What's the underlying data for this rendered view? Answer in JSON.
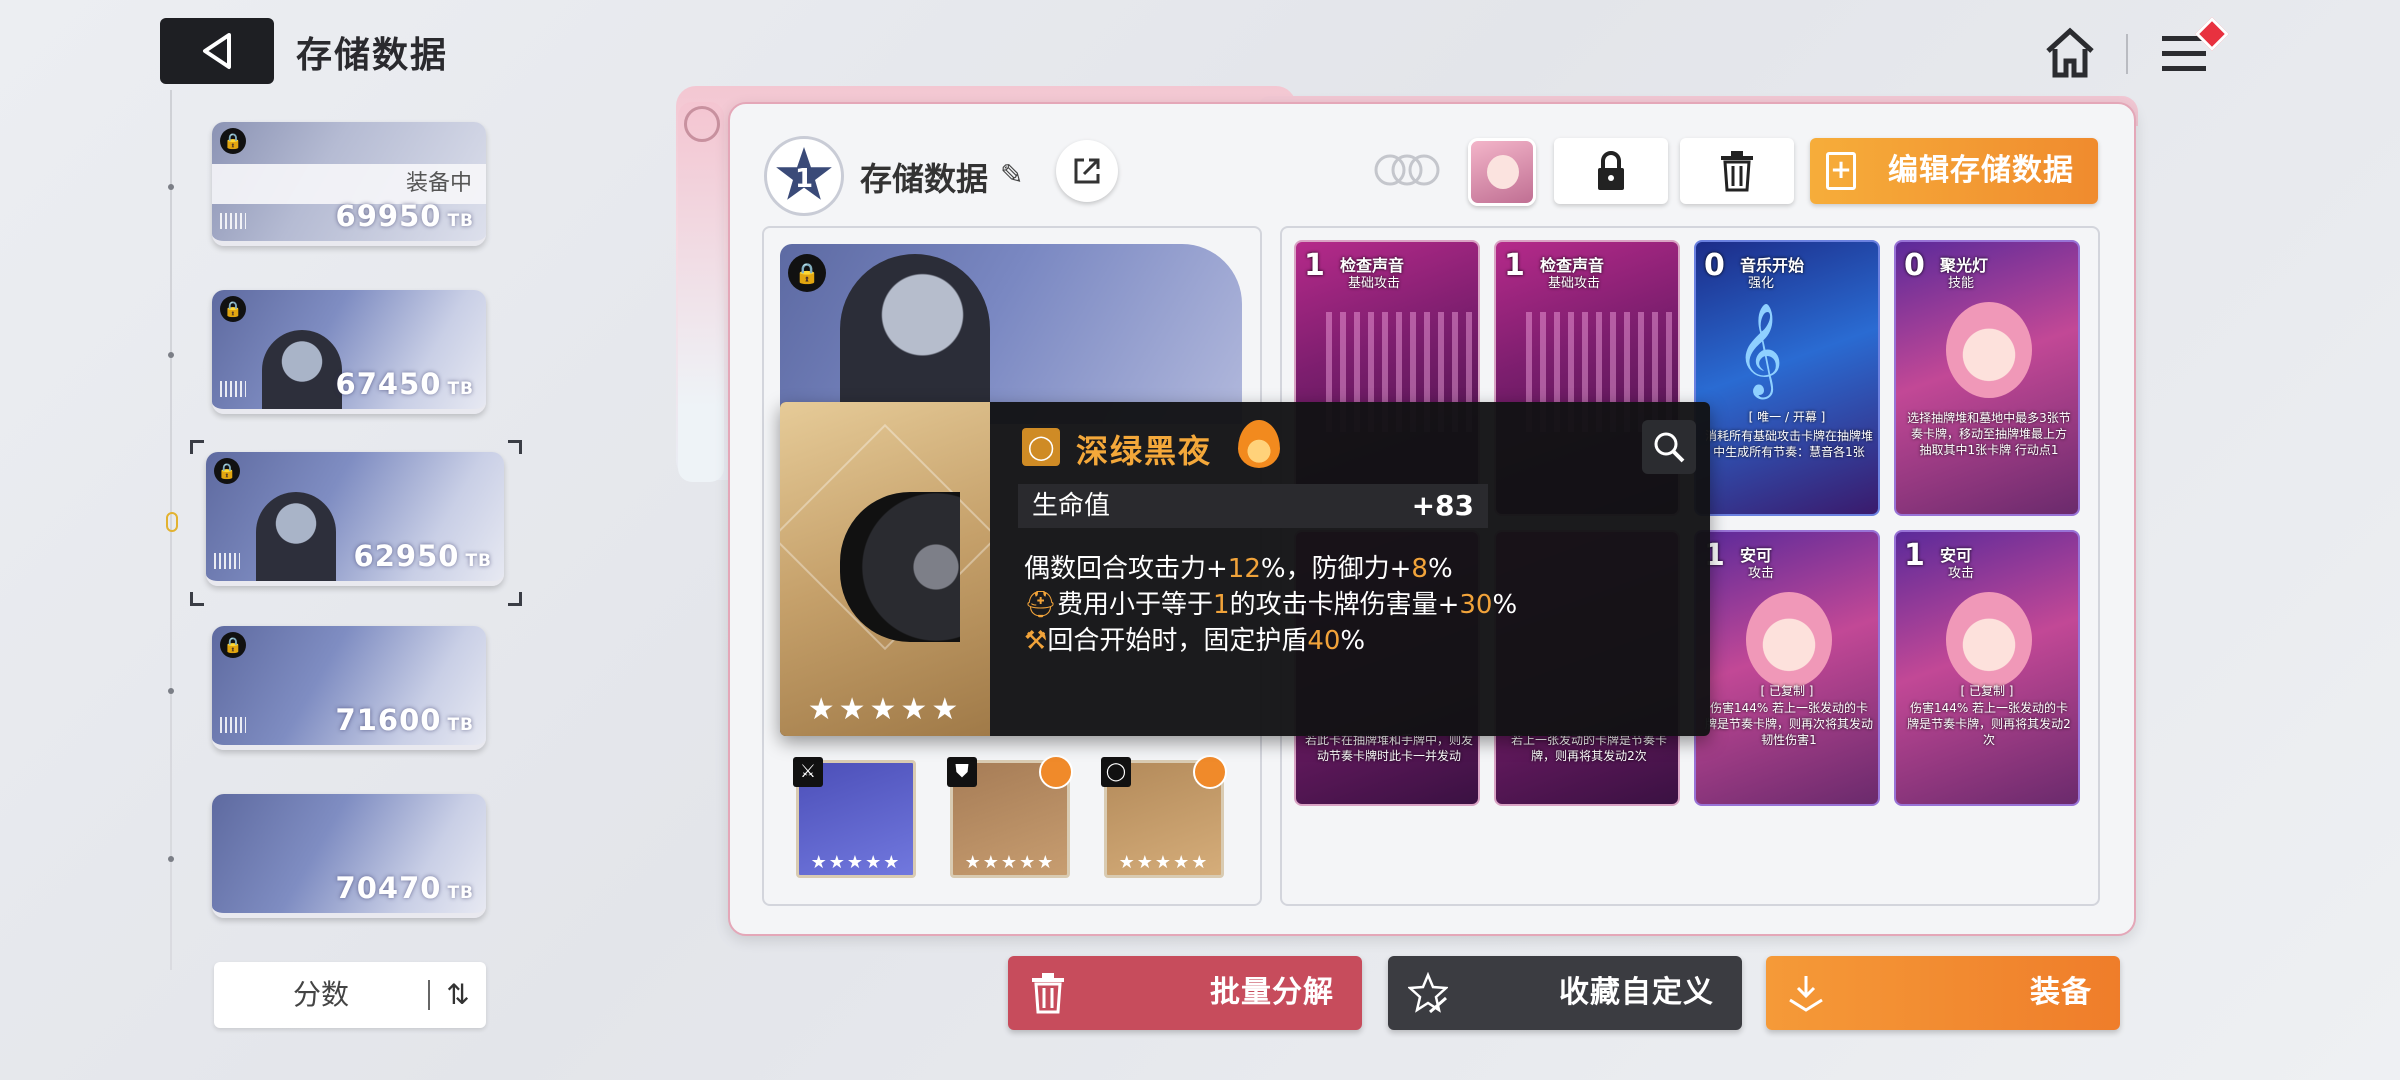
{
  "header": {
    "title": "存储数据"
  },
  "slots": [
    {
      "score": "69950",
      "unit": "TB",
      "status": "装备中"
    },
    {
      "score": "67450",
      "unit": "TB"
    },
    {
      "score": "62950",
      "unit": "TB"
    },
    {
      "score": "71600",
      "unit": "TB"
    },
    {
      "score": "70470",
      "unit": "TB"
    }
  ],
  "sort": {
    "label": "分数"
  },
  "panel": {
    "level": "1",
    "title": "存储数据",
    "edit_label": "编辑存储数据"
  },
  "popup": {
    "name": "深绿黑夜",
    "stat_name": "生命值",
    "stat_value": "+83",
    "effect1_a": "偶数回合攻击力+",
    "effect1_b": "12",
    "effect1_c": "%，防御力+",
    "effect1_d": "8",
    "effect1_e": "%",
    "effect2_a": "费用小于等于",
    "effect2_b": "1",
    "effect2_c": "的攻击卡牌伤害量+",
    "effect2_d": "30",
    "effect2_e": "%",
    "effect3_a": "回合开始时，固定护盾",
    "effect3_b": "40",
    "effect3_c": "%",
    "stars": "★★★★★"
  },
  "cards": [
    {
      "cost": "1",
      "name": "检查声音",
      "type": "基础攻击",
      "desc": "若此卡在抽牌堆和手牌中，则发动节奏卡牌时此卡一并发动"
    },
    {
      "cost": "1",
      "name": "检查声音",
      "type": "基础攻击",
      "desc": "若上一张发动的卡牌是节奏卡牌，则再将其发动2次"
    },
    {
      "cost": "0",
      "name": "音乐开始",
      "type": "强化",
      "tag": "[ 唯一 / 开幕 ]",
      "desc": "消耗所有基础攻击卡牌在抽牌堆中生成所有节奏：慧音各1张"
    },
    {
      "cost": "0",
      "name": "聚光灯",
      "type": "技能",
      "desc": "选择抽牌堆和墓地中最多3张节奏卡牌，移动至抽牌堆最上方 抽取其中1张卡牌 行动点1"
    },
    {
      "cost": "1",
      "name": "安可",
      "type": "攻击",
      "tag": "[ 已复制 ]",
      "desc": "伤害144% 若上一张发动的卡牌是节奏卡牌，则再次将其发动 韧性伤害1"
    },
    {
      "cost": "1",
      "name": "安可",
      "type": "攻击",
      "tag": "[ 已复制 ]",
      "desc": "伤害144% 若上一张发动的卡牌是节奏卡牌，则再将其发动2次"
    }
  ],
  "equipment": [
    {
      "stars": "★★★★★"
    },
    {
      "stars": "★★★★★"
    },
    {
      "stars": "★★★★★"
    }
  ],
  "actions": {
    "decompose": "批量分解",
    "favorite": "收藏自定义",
    "equip": "装备"
  }
}
